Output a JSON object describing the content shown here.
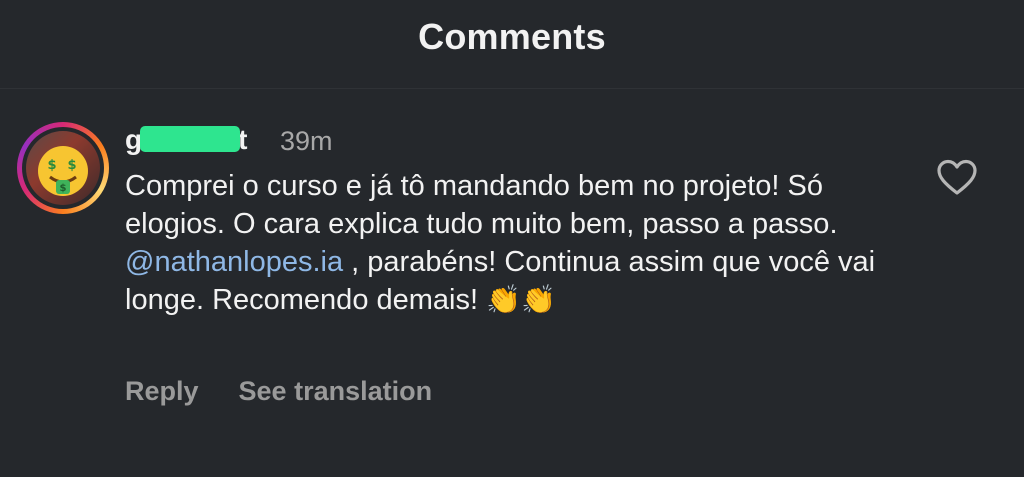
{
  "header": {
    "title": "Comments"
  },
  "comment": {
    "username_prefix": "g",
    "username_suffix": "t",
    "time": "39m",
    "text_before": "Comprei o curso e já tô mandando bem no projeto! Só elogios. O cara explica tudo muito bem, passo a passo. ",
    "mention": "@nathanlopes.ia",
    "text_after": " , parabéns! Continua assim que você vai longe. Recomendo demais! ",
    "emojis": "👏👏",
    "actions": {
      "reply": "Reply",
      "translate": "See translation"
    }
  },
  "icons": {
    "like": "heart-outline-icon",
    "avatar_emoji": "money-mouth-face"
  },
  "colors": {
    "background": "#25282c",
    "mention": "#8fb8e6",
    "redaction": "#2ee58f",
    "muted": "#a8a8a8"
  }
}
